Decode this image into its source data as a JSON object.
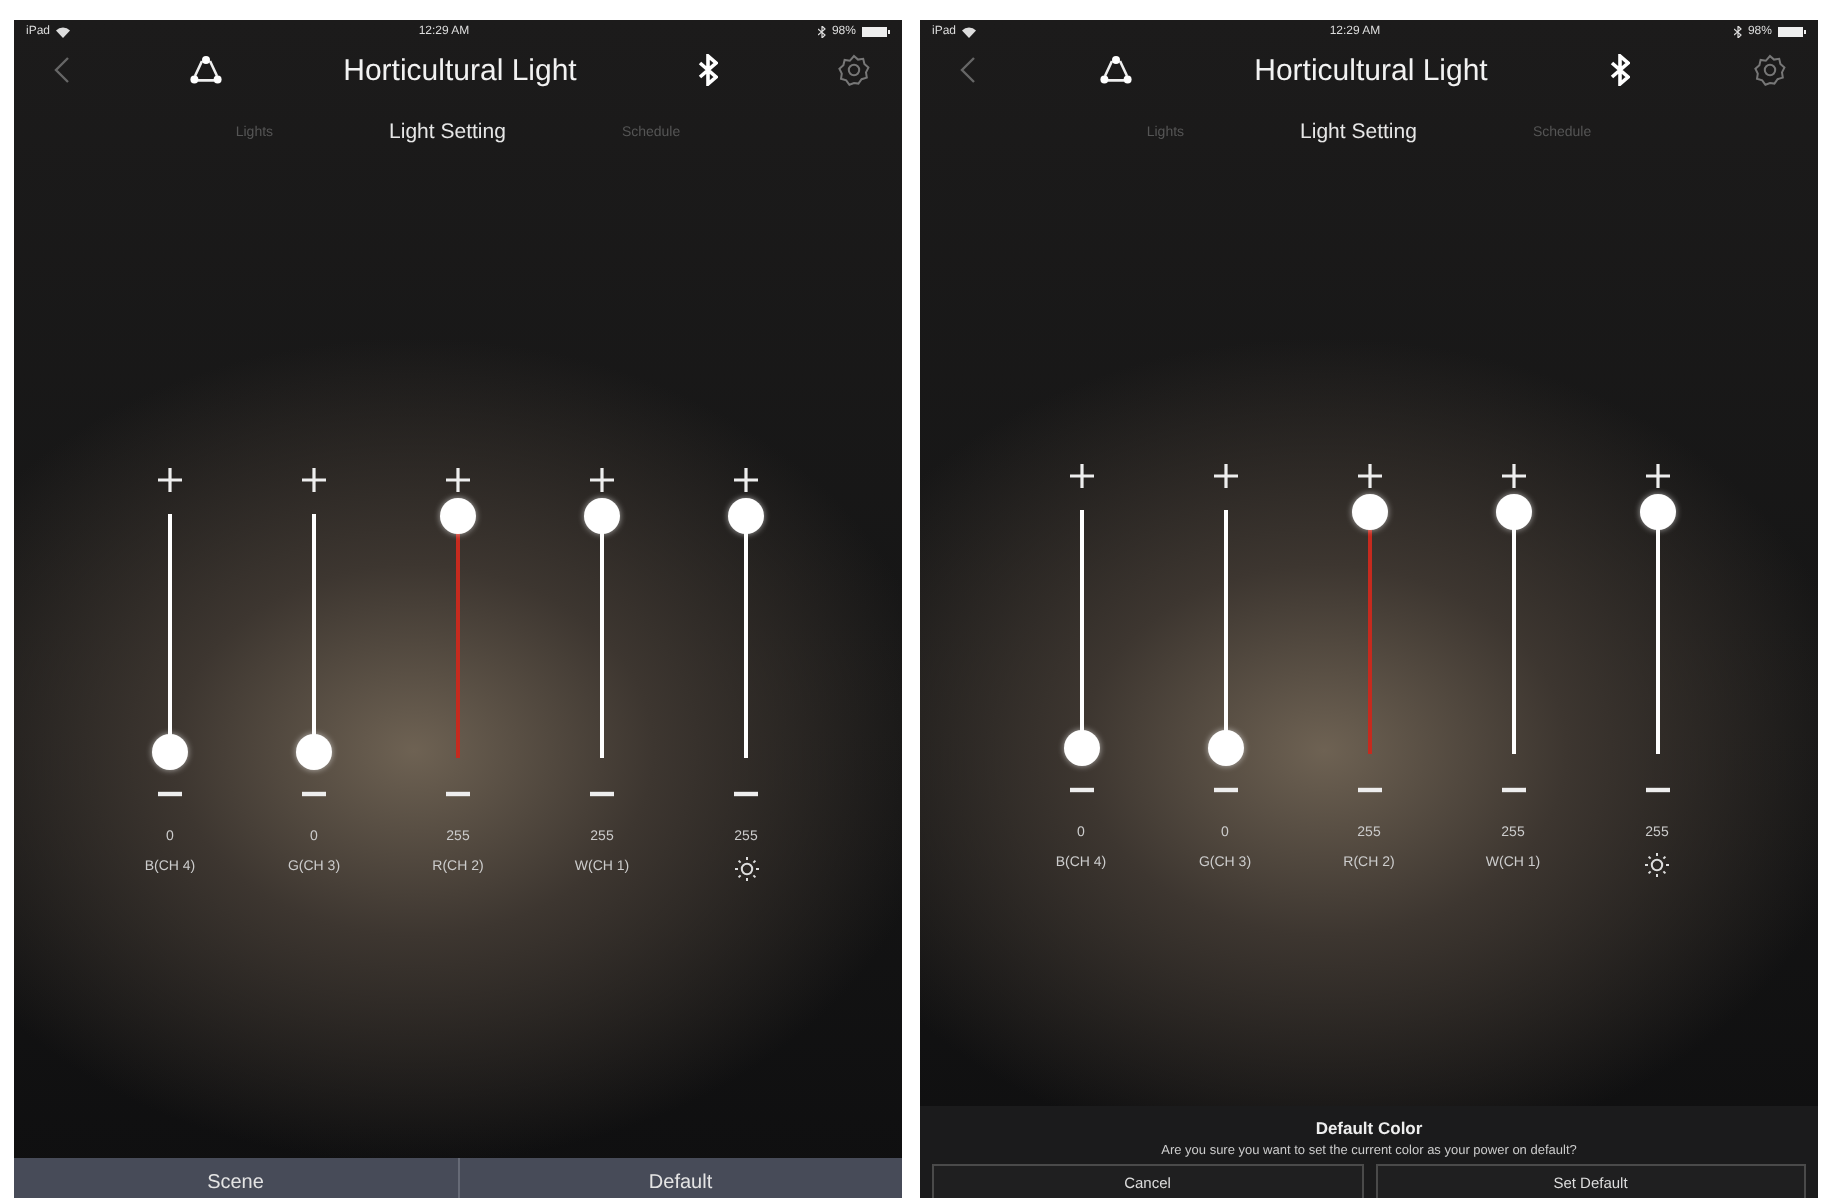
{
  "screens": [
    {
      "status_bar": {
        "device": "iPad",
        "time": "12:29 AM",
        "battery": "98%"
      },
      "title": "Horticultural Light",
      "tabs": [
        {
          "label": "Lights",
          "selected": false
        },
        {
          "label": "Light Setting",
          "selected": true
        },
        {
          "label": "Schedule",
          "selected": false
        }
      ],
      "sliders": [
        {
          "kind": "channel",
          "label": "B(CH 4)",
          "value": "0",
          "level": 0,
          "color": "#ffffff"
        },
        {
          "kind": "channel",
          "label": "G(CH 3)",
          "value": "0",
          "level": 0,
          "color": "#ffffff"
        },
        {
          "kind": "channel",
          "label": "R(CH 2)",
          "value": "255",
          "level": 1,
          "color": "#c62a1e"
        },
        {
          "kind": "channel",
          "label": "W(CH 1)",
          "value": "255",
          "level": 1,
          "color": "#ffffff"
        },
        {
          "kind": "brightness",
          "value": "255",
          "level": 1,
          "color": "#ffffff"
        }
      ],
      "bottom_bar": {
        "buttons": [
          "Scene",
          "Default"
        ]
      }
    },
    {
      "status_bar": {
        "device": "iPad",
        "time": "12:29 AM",
        "battery": "98%"
      },
      "title": "Horticultural Light",
      "tabs": [
        {
          "label": "Lights",
          "selected": false
        },
        {
          "label": "Light Setting",
          "selected": true
        },
        {
          "label": "Schedule",
          "selected": false
        }
      ],
      "sliders": [
        {
          "kind": "channel",
          "label": "B(CH 4)",
          "value": "0",
          "level": 0,
          "color": "#ffffff"
        },
        {
          "kind": "channel",
          "label": "G(CH 3)",
          "value": "0",
          "level": 0,
          "color": "#ffffff"
        },
        {
          "kind": "channel",
          "label": "R(CH 2)",
          "value": "255",
          "level": 1,
          "color": "#c62a1e"
        },
        {
          "kind": "channel",
          "label": "W(CH 1)",
          "value": "255",
          "level": 1,
          "color": "#ffffff"
        },
        {
          "kind": "brightness",
          "value": "255",
          "level": 1,
          "color": "#ffffff"
        }
      ],
      "dialog": {
        "title": "Default Color",
        "message": "Are you sure you want to set the current color as your power on default?",
        "buttons": [
          "Cancel",
          "Set Default"
        ]
      }
    }
  ]
}
